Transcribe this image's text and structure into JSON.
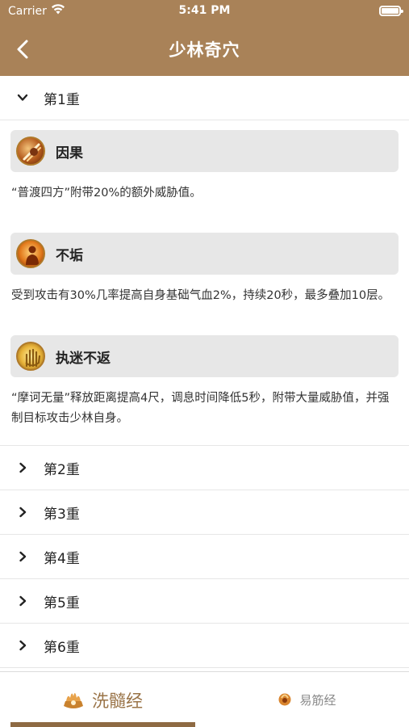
{
  "status_bar": {
    "carrier": "Carrier",
    "time": "5:41 PM",
    "icons": [
      "wifi-icon",
      "battery-icon"
    ]
  },
  "nav": {
    "title": "少林奇穴",
    "back_icon": "chevron-left-icon"
  },
  "sections": [
    {
      "label": "第1重",
      "expanded": true,
      "items": [
        {
          "name": "因果",
          "icon": "fist-strike-icon",
          "description": "“普渡四方”附带20%的额外威胁值。"
        },
        {
          "name": "不垢",
          "icon": "monk-body-icon",
          "description": "受到攻击有30%几率提高自身基础气血2%，持续20秒，最多叠加10层。"
        },
        {
          "name": "执迷不返",
          "icon": "golden-palm-icon",
          "description": "“摩诃无量”释放距离提高4尺，调息时间降低5秒，附带大量威胁值，并强制目标攻击少林自身。"
        }
      ]
    },
    {
      "label": "第2重",
      "expanded": false
    },
    {
      "label": "第3重",
      "expanded": false
    },
    {
      "label": "第4重",
      "expanded": false
    },
    {
      "label": "第5重",
      "expanded": false
    },
    {
      "label": "第6重",
      "expanded": false
    }
  ],
  "tabs": [
    {
      "label": "洗髓经",
      "icon": "xisui-emblem-icon",
      "active": true
    },
    {
      "label": "易筋经",
      "icon": "yijin-emblem-icon",
      "active": false
    }
  ],
  "colors": {
    "header_bg": "#a98258",
    "active_tab": "#9a7448",
    "indicator": "#8e6a43",
    "card_bg": "#e7e7e7"
  }
}
